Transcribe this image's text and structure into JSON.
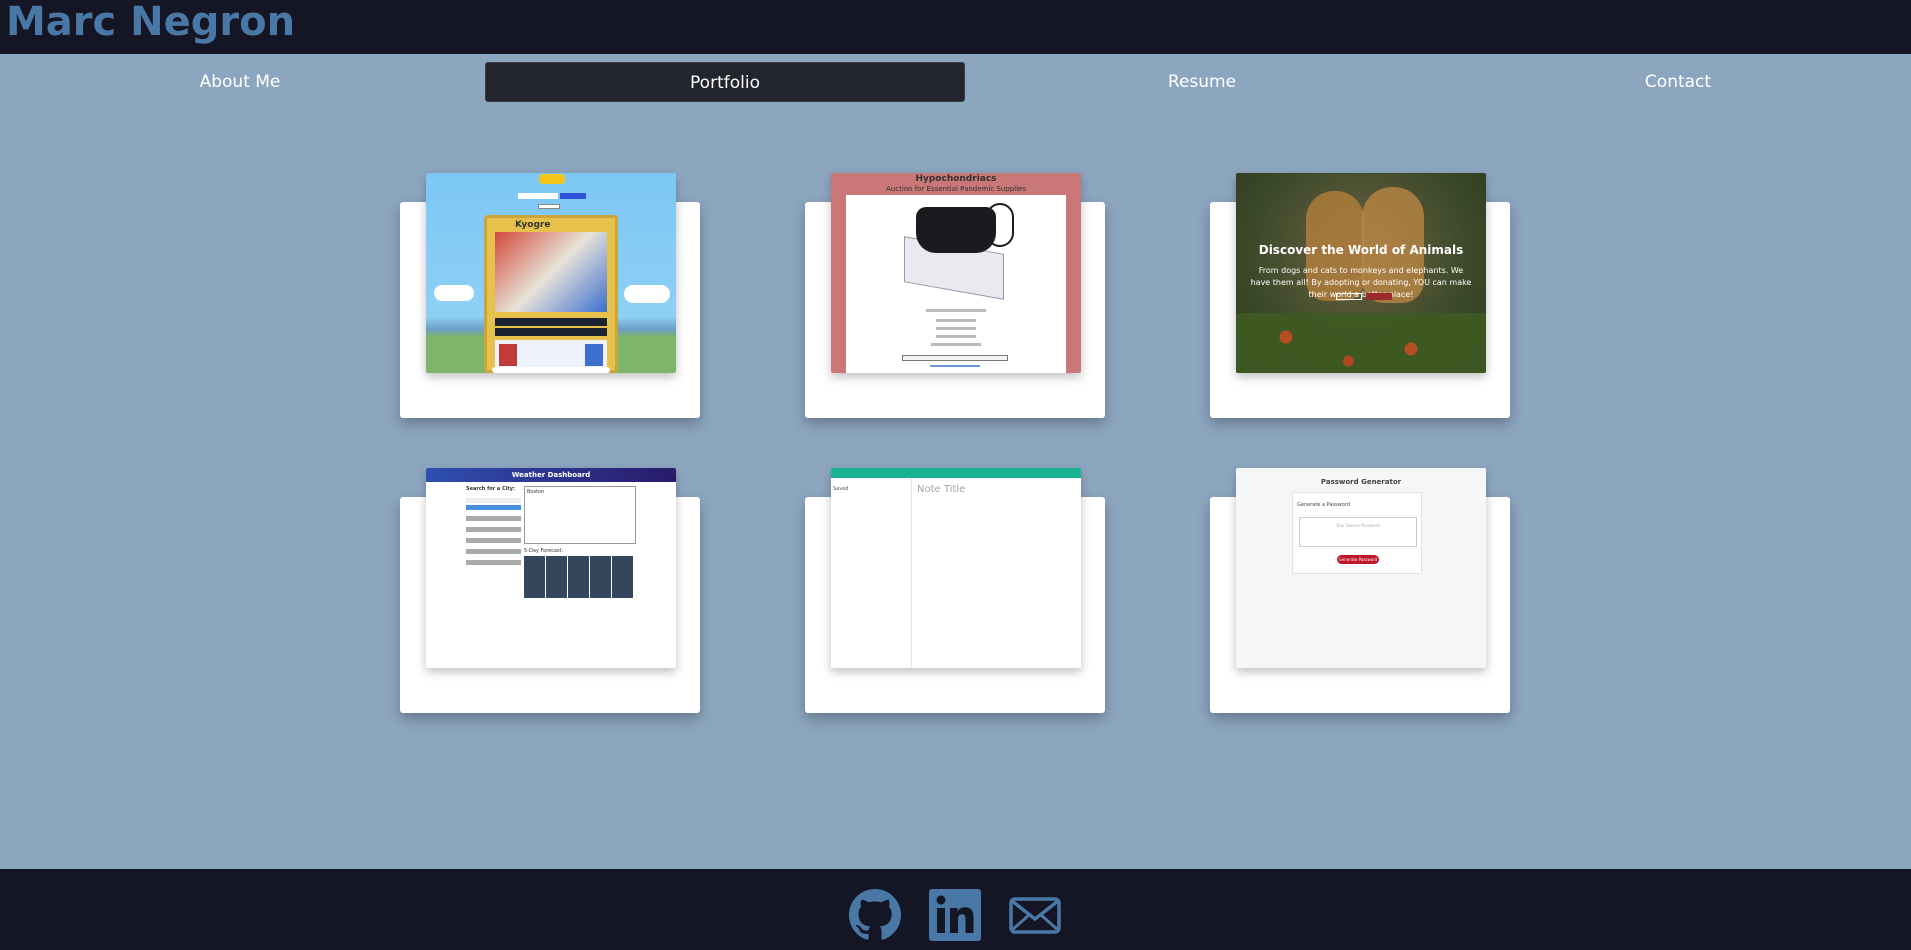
{
  "header": {
    "brand": "Marc Negron",
    "brand_color": "#4a78a6"
  },
  "nav": {
    "items": [
      {
        "label": "About Me",
        "active": false
      },
      {
        "label": "Portfolio",
        "active": true
      },
      {
        "label": "Resume",
        "active": false
      },
      {
        "label": "Contact",
        "active": false
      }
    ]
  },
  "portfolio": {
    "projects": [
      {
        "name": "pokemon-card-project",
        "card_name": "Kyogre"
      },
      {
        "name": "hypochondriacs-project",
        "title": "Hypochondriacs",
        "subtitle": "Auction for Essential Pandemic Supplies"
      },
      {
        "name": "animals-project",
        "heading": "Discover the World of Animals",
        "text": "From dogs and cats to monkeys and elephants. We have them all! By adopting or donating, YOU can make their world a better place!"
      },
      {
        "name": "weather-dashboard-project",
        "title": "Weather Dashboard",
        "search_label": "Search for a City:",
        "city": "Boston",
        "forecast_label": "5-Day Forecast:"
      },
      {
        "name": "note-taker-project",
        "note_title": "Note Title",
        "saved": "Saved"
      },
      {
        "name": "password-generator-project",
        "title": "Password Generator",
        "label": "Generate a Password",
        "placeholder": "Your Secure Password",
        "button": "Generate Password"
      }
    ]
  },
  "footer": {
    "icons": [
      "github-icon",
      "linkedin-icon",
      "email-icon"
    ],
    "icon_color": "#4a78a6"
  }
}
